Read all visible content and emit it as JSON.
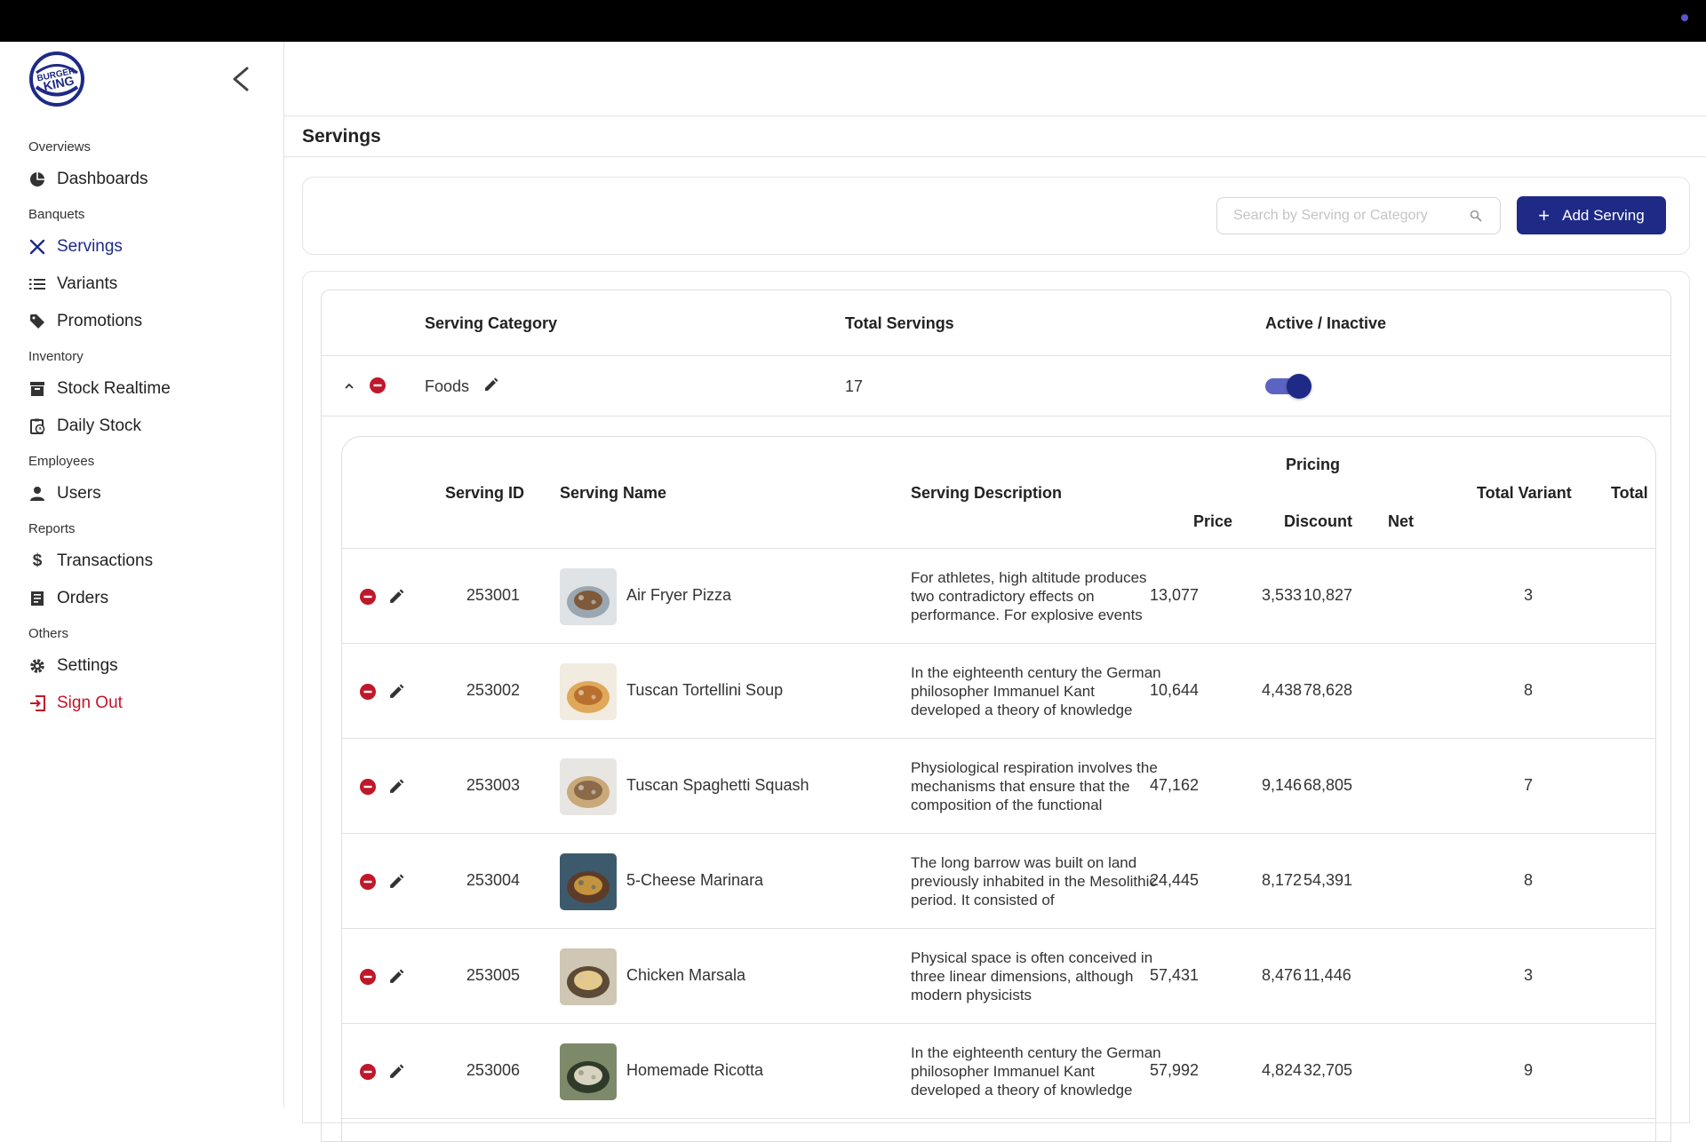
{
  "brand": {
    "logo_text_line1": "BURGER",
    "logo_text_line2": "KING",
    "colors": {
      "accent": "#1e2a86",
      "danger": "#c0172a",
      "toggle_track": "#5b64c3"
    }
  },
  "sidebar": {
    "collapse_icon": "chevron-left-icon",
    "sections": [
      {
        "title": "Overviews",
        "items": [
          {
            "label": "Dashboards",
            "icon": "pie-chart-icon"
          }
        ]
      },
      {
        "title": "Banquets",
        "items": [
          {
            "label": "Servings",
            "icon": "utensils-icon",
            "active": true
          },
          {
            "label": "Variants",
            "icon": "list-icon"
          },
          {
            "label": "Promotions",
            "icon": "tag-icon"
          }
        ]
      },
      {
        "title": "Inventory",
        "items": [
          {
            "label": "Stock Realtime",
            "icon": "archive-icon"
          },
          {
            "label": "Daily Stock",
            "icon": "clipboard-clock-icon"
          }
        ]
      },
      {
        "title": "Employees",
        "items": [
          {
            "label": "Users",
            "icon": "user-icon"
          }
        ]
      },
      {
        "title": "Reports",
        "items": [
          {
            "label": "Transactions",
            "icon": "dollar-icon"
          },
          {
            "label": "Orders",
            "icon": "receipt-icon"
          }
        ]
      },
      {
        "title": "Others",
        "items": [
          {
            "label": "Settings",
            "icon": "gear-icon"
          },
          {
            "label": "Sign Out",
            "icon": "sign-out-icon"
          }
        ]
      }
    ]
  },
  "page": {
    "title": "Servings"
  },
  "toolbar": {
    "search_placeholder": "Search by Serving or Category",
    "add_label": "Add Serving"
  },
  "category_table": {
    "headers": {
      "category": "Serving Category",
      "total": "Total Servings",
      "active": "Active / Inactive"
    },
    "rows": [
      {
        "name": "Foods",
        "total": "17",
        "active": true,
        "expanded": true
      }
    ]
  },
  "servings_table": {
    "headers": {
      "id": "Serving ID",
      "name": "Serving Name",
      "description": "Serving Description",
      "pricing": "Pricing",
      "price": "Price",
      "discount": "Discount",
      "net": "Net",
      "total_variant": "Total Variant",
      "total": "Total"
    },
    "rows": [
      {
        "id": "253001",
        "name": "Air Fryer Pizza",
        "description": "For athletes, high altitude produces two contradictory effects on performance. For explosive events",
        "price": "13,077",
        "discount": "3,533",
        "net": "10,827",
        "total_variant": "3"
      },
      {
        "id": "253002",
        "name": "Tuscan Tortellini Soup",
        "description": "In the eighteenth century the German philosopher Immanuel Kant developed a theory of knowledge",
        "price": "10,644",
        "discount": "4,438",
        "net": "78,628",
        "total_variant": "8"
      },
      {
        "id": "253003",
        "name": "Tuscan Spaghetti Squash",
        "description": "Physiological respiration involves the mechanisms that ensure that the composition of the functional",
        "price": "47,162",
        "discount": "9,146",
        "net": "68,805",
        "total_variant": "7"
      },
      {
        "id": "253004",
        "name": "5-Cheese Marinara",
        "description": "The long barrow was built on land previously inhabited in the Mesolithic period. It consisted of",
        "price": "24,445",
        "discount": "8,172",
        "net": "54,391",
        "total_variant": "8"
      },
      {
        "id": "253005",
        "name": "Chicken Marsala",
        "description": "Physical space is often conceived in three linear dimensions, although modern physicists",
        "price": "57,431",
        "discount": "8,476",
        "net": "11,446",
        "total_variant": "3"
      },
      {
        "id": "253006",
        "name": "Homemade Ricotta",
        "description": "In the eighteenth century the German philosopher Immanuel Kant developed a theory of knowledge",
        "price": "57,992",
        "discount": "4,824",
        "net": "32,705",
        "total_variant": "9"
      }
    ]
  }
}
